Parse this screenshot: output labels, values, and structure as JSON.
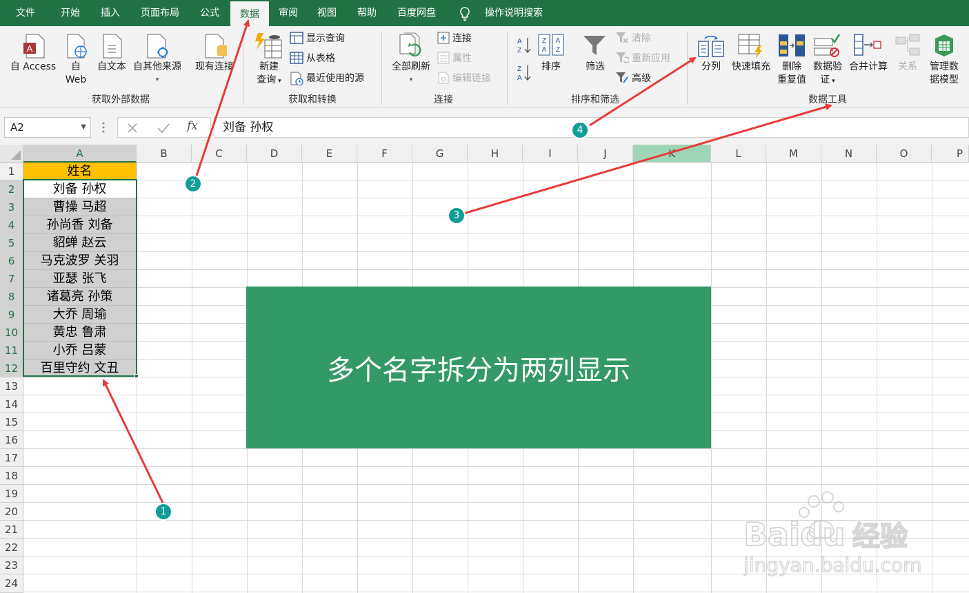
{
  "menu": {
    "tabs": [
      "文件",
      "开始",
      "插入",
      "页面布局",
      "公式",
      "数据",
      "审阅",
      "视图",
      "帮助",
      "百度网盘"
    ],
    "active_tab": "数据",
    "search": "操作说明搜索"
  },
  "ribbon": {
    "external": {
      "access": "自 Access",
      "web_1": "自",
      "web_2": "Web",
      "text": "自文本",
      "other": "自其他来源",
      "group": "获取外部数据"
    },
    "existing": "现有连接",
    "transform": {
      "new_query_1": "新建",
      "new_query_2": "查询",
      "show_queries": "显示查询",
      "from_table": "从表格",
      "recent_sources": "最近使用的源",
      "group": "获取和转换"
    },
    "connections": {
      "refresh_all": "全部刷新",
      "connections": "连接",
      "properties": "属性",
      "edit_links": "编辑链接",
      "group": "连接"
    },
    "sort_filter": {
      "sort": "排序",
      "filter": "筛选",
      "clear": "清除",
      "reapply": "重新应用",
      "advanced": "高级",
      "group": "排序和筛选"
    },
    "data_tools": {
      "text_to_columns": "分列",
      "flash_fill": "快速填充",
      "remove_dup_1": "删除",
      "remove_dup_2": "重复值",
      "validation_1": "数据验",
      "validation_2": "证",
      "consolidate": "合并计算",
      "relationships": "关系",
      "data_model_1": "管理数",
      "data_model_2": "据模型",
      "group": "数据工具"
    }
  },
  "formula_bar": {
    "name_box": "A2",
    "fx": "fx",
    "content": "刘备 孙权"
  },
  "grid": {
    "columns": [
      "A",
      "B",
      "C",
      "D",
      "E",
      "F",
      "G",
      "H",
      "I",
      "J",
      "K",
      "L",
      "M",
      "N",
      "O",
      "P"
    ],
    "rows": [
      "1",
      "2",
      "3",
      "4",
      "5",
      "6",
      "7",
      "8",
      "9",
      "10",
      "11",
      "12",
      "13",
      "14",
      "15",
      "16",
      "17",
      "18",
      "19",
      "20",
      "21",
      "22",
      "23",
      "24"
    ],
    "header_cell": "姓名",
    "names": [
      "刘备  孙权",
      "曹操  马超",
      "孙尚香  刘备",
      "貂蝉  赵云",
      "马克波罗  关羽",
      "亚瑟  张飞",
      "诸葛亮  孙策",
      "大乔  周瑜",
      "黄忠  鲁肃",
      "小乔  吕蒙",
      "百里守约  文丑"
    ]
  },
  "banner": "多个名字拆分为两列显示",
  "badges": [
    "1",
    "2",
    "3",
    "4"
  ],
  "watermark": {
    "brand": "Baidu",
    "service": "经验",
    "url": "jingyan.baidu.com"
  },
  "colors": {
    "excel_green": "#217346",
    "header_fill": "#ffc000",
    "banner_fill": "#339966",
    "badge": "#119c98",
    "arrow": "#e83a3a"
  }
}
